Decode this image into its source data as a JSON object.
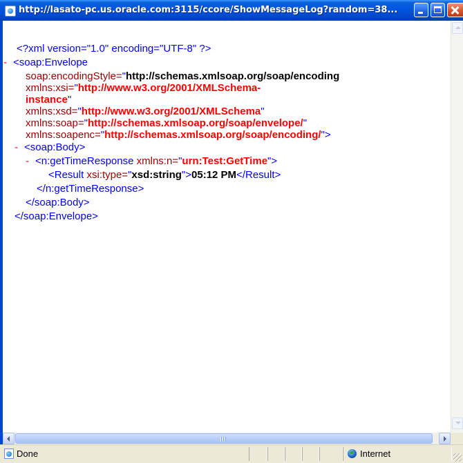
{
  "window": {
    "title": "http://lasato-pc.us.oracle.com:3115/ccore/ShowMessageLog?random=38..."
  },
  "xml": {
    "declaration": "<?xml version=\"1.0\" encoding=\"UTF-8\" ?>",
    "envelope_open": {
      "marker": "-",
      "tag": "<soap:Envelope",
      "attrs": [
        {
          "name": "soap:encodingStyle=",
          "value": "http://schemas.xmlsoap.org/soap/encoding"
        },
        {
          "name": "xmlns:xsi=",
          "value": "http://www.w3.org/2001/XMLSchema-",
          "value_cont": "instance"
        },
        {
          "name": "xmlns:xsd=",
          "value": "http://www.w3.org/2001/XMLSchema"
        },
        {
          "name": "xmlns:soap=",
          "value": "http://schemas.xmlsoap.org/soap/envelope/"
        },
        {
          "name": "xmlns:soapenc=",
          "value": "http://schemas.xmlsoap.org/soap/encoding/"
        }
      ]
    },
    "body_open": {
      "marker": "-",
      "tag": "<soap:Body>"
    },
    "response_open": {
      "marker": "-",
      "tag": "<n:getTimeResponse",
      "attr_name": "xmlns:n=",
      "attr_value": "urn:Test:GetTime"
    },
    "result": {
      "tag": "<Result",
      "attr_name": "xsi:type=",
      "attr_value": "xsd:string",
      "text": "05:12 PM",
      "close": "</Result>"
    },
    "response_close": "</n:getTimeResponse>",
    "body_close": "</soap:Body>",
    "envelope_close": "</soap:Envelope>"
  },
  "status": {
    "text": "Done",
    "zone": "Internet"
  }
}
